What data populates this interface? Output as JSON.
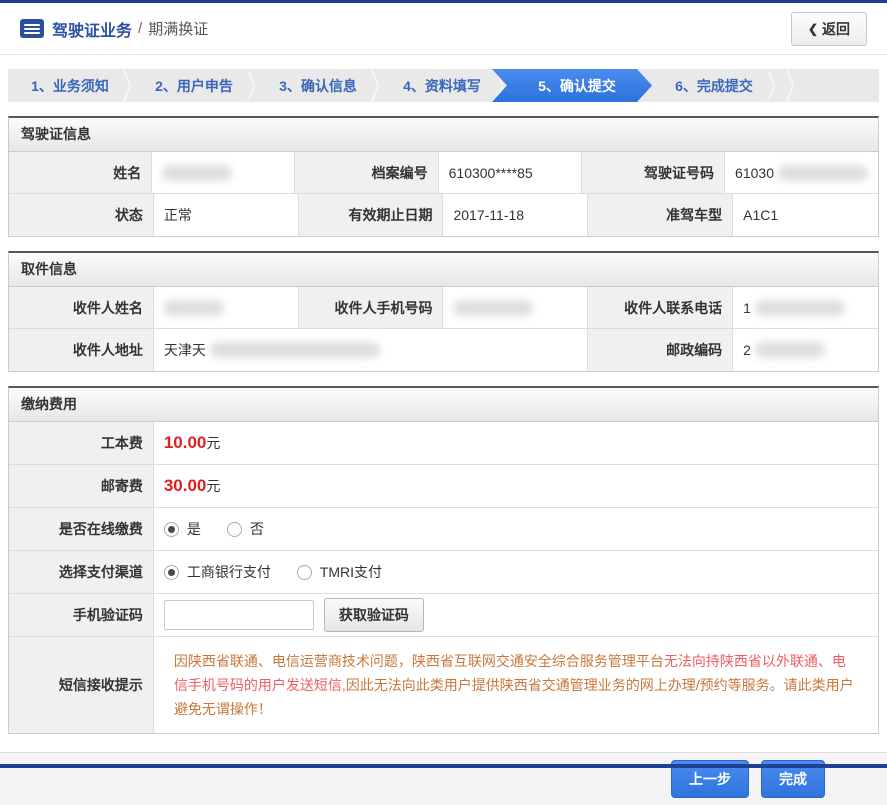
{
  "page": {
    "breadcrumb_root": "驾驶证业务",
    "breadcrumb_sep": "/",
    "breadcrumb_current": "期满换证",
    "back_icon": "❮",
    "back_label": "返回"
  },
  "steps": {
    "items": [
      {
        "label": "1、业务须知",
        "active": false
      },
      {
        "label": "2、用户申告",
        "active": false
      },
      {
        "label": "3、确认信息",
        "active": false
      },
      {
        "label": "4、资料填写",
        "active": false
      },
      {
        "label": "5、确认提交",
        "active": true
      },
      {
        "label": "6、完成提交",
        "active": false
      }
    ]
  },
  "license_section": {
    "title": "驾驶证信息",
    "name_label": "姓名",
    "file_no_label": "档案编号",
    "file_no_value": "610300****85",
    "license_no_label": "驾驶证号码",
    "license_no_prefix": "61030",
    "status_label": "状态",
    "status_value": "正常",
    "valid_until_label": "有效期止日期",
    "valid_until_value": "2017-11-18",
    "vehicle_type_label": "准驾车型",
    "vehicle_type_value": "A1C1"
  },
  "pickup_section": {
    "title": "取件信息",
    "recipient_name_label": "收件人姓名",
    "recipient_mobile_label": "收件人手机号码",
    "recipient_phone_label": "收件人联系电话",
    "recipient_phone_prefix": "1",
    "recipient_address_label": "收件人地址",
    "recipient_address_prefix": "天津天",
    "postal_code_label": "邮政编码",
    "postal_code_prefix": "2"
  },
  "payment_section": {
    "title": "缴纳费用",
    "work_fee_label": "工本费",
    "work_fee_value": "10.00",
    "mail_fee_label": "邮寄费",
    "mail_fee_value": "30.00",
    "fee_unit": "元",
    "online_pay_label": "是否在线缴费",
    "online_yes": "是",
    "online_no": "否",
    "channel_label": "选择支付渠道",
    "channel_icbc": "工商银行支付",
    "channel_tmri": "TMRI支付",
    "sms_code_label": "手机验证码",
    "get_code_button": "获取验证码",
    "sms_tip_label": "短信接收提示",
    "sms_tip_part1": "因陕西省联通、电信运营商技术问题，陕西省互联网交通安全综合服务管理平台",
    "sms_tip_emphasis": "无法向持陕西省以外联通、电信手机号码的用户发送短信,",
    "sms_tip_part2": "因此无法向此类用户提供陕西省交通管理业务的网上办理/预约等服务。请此类用户避免无谓操作！"
  },
  "footer": {
    "prev_button": "上一步",
    "finish_button": "完成"
  },
  "colors": {
    "accent_blue": "#2e78e4",
    "navy": "#1e4194",
    "fee_red": "#e02020",
    "warning_emphasis": "#f05e5e",
    "warning_normal": "#c9773b"
  }
}
